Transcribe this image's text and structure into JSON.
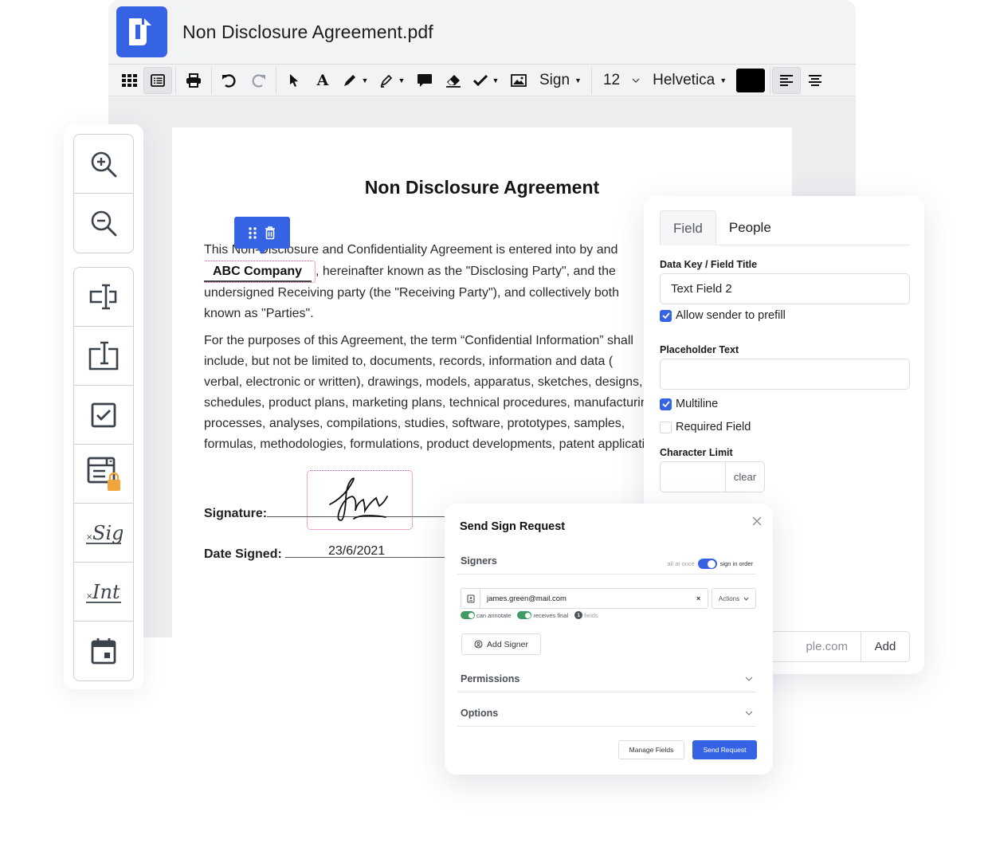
{
  "app": {
    "file_name": "Non Disclosure Agreement.pdf",
    "brand_color": "#3563e3"
  },
  "toolbar": {
    "items": [
      {
        "icon": "grid-icon"
      },
      {
        "icon": "list-view-icon",
        "active": true
      },
      {
        "icon": "print-icon"
      },
      {
        "icon": "undo-icon"
      },
      {
        "icon": "redo-icon"
      },
      {
        "icon": "pointer-icon"
      },
      {
        "icon": "text-icon"
      },
      {
        "icon": "pen-icon",
        "has_dropdown": true
      },
      {
        "icon": "highlighter-icon",
        "has_dropdown": true
      },
      {
        "icon": "comment-icon"
      },
      {
        "icon": "eraser-icon"
      },
      {
        "icon": "checkmark-icon",
        "has_dropdown": true
      },
      {
        "icon": "image-icon"
      }
    ],
    "sign_label": "Sign",
    "font_size": "12",
    "font_family": "Helvetica",
    "text_color": "#000000",
    "align_left_active": true
  },
  "tools_panel": {
    "zoom": [
      "zoom-in-icon",
      "zoom-out-icon"
    ],
    "fields": [
      "text-field-icon",
      "text-area-icon",
      "checkbox-field-icon",
      "locked-dropdown-icon",
      "signature-field-icon",
      "initials-field-icon",
      "date-field-icon"
    ],
    "signature_glyph": "Sig",
    "initials_glyph": "Int",
    "lock_color": "#f0a63b"
  },
  "document": {
    "title": "Non Disclosure Agreement",
    "para1": {
      "pre": "This Non-Disclosure and Confidentiality Agreement is entered into by and",
      "field_value": "ABC Company",
      "line2": ", hereinafter known as the \"Disclosing Party\", and the",
      "line3": "undersigned Receiving party (the \"Receiving Party\"), and collectively both",
      "line4": "known as \"Parties\"."
    },
    "para2": [
      "For the purposes of this Agreement, the term “Confidential Information” shall",
      "include, but not be limited to, documents, records, information and data (",
      "verbal, electronic or written), drawings, models, apparatus, sketches, designs,",
      "schedules, product plans, marketing plans, technical procedures, manufacturing",
      "processes, analyses, compilations, studies, software, prototypes, samples,",
      "formulas, methodologies, formulations, product developments, patent applications"
    ],
    "signature_label": "Signature:",
    "date_label": "Date Signed:",
    "date_value": "23/6/2021",
    "field_highlight_color": "#e24aa0"
  },
  "field_panel": {
    "tabs": [
      {
        "label": "Field",
        "active": true
      },
      {
        "label": "People",
        "active": false
      }
    ],
    "data_key_label": "Data Key / Field Title",
    "data_key_value": "Text Field 2",
    "allow_prefill_label": "Allow sender to prefill",
    "allow_prefill": true,
    "placeholder_label": "Placeholder Text",
    "placeholder_value": "",
    "multiline_label": "Multiline",
    "multiline": true,
    "required_label": "Required Field",
    "required": false,
    "char_limit_label": "Character Limit",
    "char_limit_value": "",
    "clear_label": "clear",
    "email_placeholder": "name@example.com",
    "email_visible": "ple.com",
    "add_label": "Add"
  },
  "sign_request": {
    "title": "Send Sign Request",
    "signers_label": "Signers",
    "order_off_label": "all at once",
    "order_on_label": "sign in order",
    "sign_in_order": true,
    "signers": [
      {
        "email": "james.green@mail.com",
        "can_annotate": true,
        "can_annotate_label": "can annotate",
        "receives_final": true,
        "receives_final_label": "receives final",
        "fields_count": "1",
        "fields_label": "fields"
      }
    ],
    "actions_label": "Actions",
    "add_signer_label": "Add Signer",
    "permissions_label": "Permissions",
    "options_label": "Options",
    "manage_fields_label": "Manage Fields",
    "send_label": "Send Request"
  }
}
